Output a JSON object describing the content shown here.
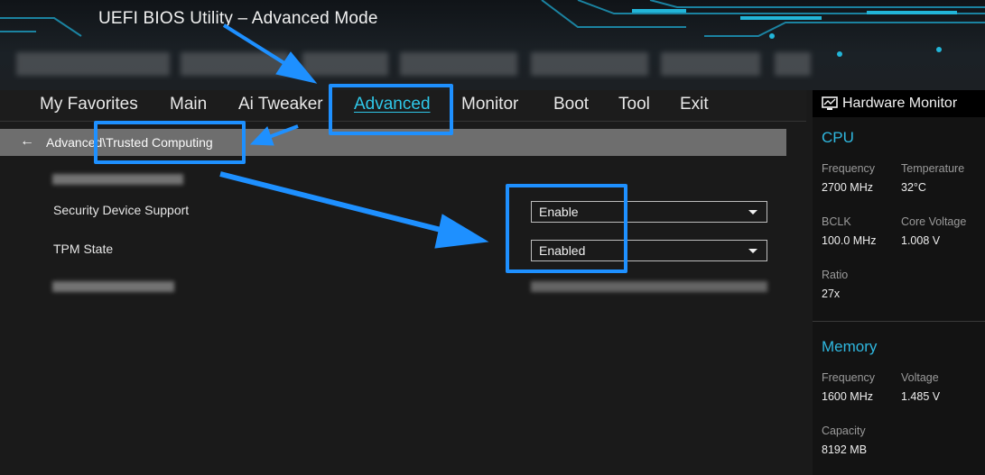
{
  "window": {
    "title": "UEFI BIOS Utility – Advanced Mode"
  },
  "nav": {
    "tabs": [
      "My Favorites",
      "Main",
      "Ai Tweaker",
      "Advanced",
      "Monitor",
      "Boot",
      "Tool",
      "Exit"
    ],
    "active": "Advanced"
  },
  "breadcrumb": {
    "back_icon": "arrow-left-icon",
    "path": "Advanced\\Trusted Computing"
  },
  "settings": [
    {
      "label": "Security Device Support",
      "value": "Enable"
    },
    {
      "label": "TPM State",
      "value": "Enabled"
    }
  ],
  "hardware_monitor": {
    "title": "Hardware Monitor",
    "cpu": {
      "heading": "CPU",
      "frequency_label": "Frequency",
      "frequency": "2700 MHz",
      "temperature_label": "Temperature",
      "temperature": "32°C",
      "bclk_label": "BCLK",
      "bclk": "100.0 MHz",
      "core_voltage_label": "Core Voltage",
      "core_voltage": "1.008 V",
      "ratio_label": "Ratio",
      "ratio": "27x"
    },
    "memory": {
      "heading": "Memory",
      "frequency_label": "Frequency",
      "frequency": "1600 MHz",
      "voltage_label": "Voltage",
      "voltage": "1.485 V",
      "capacity_label": "Capacity",
      "capacity": "8192 MB"
    }
  },
  "colors": {
    "accent": "#2fc7e8",
    "annotation": "#1e90ff"
  }
}
